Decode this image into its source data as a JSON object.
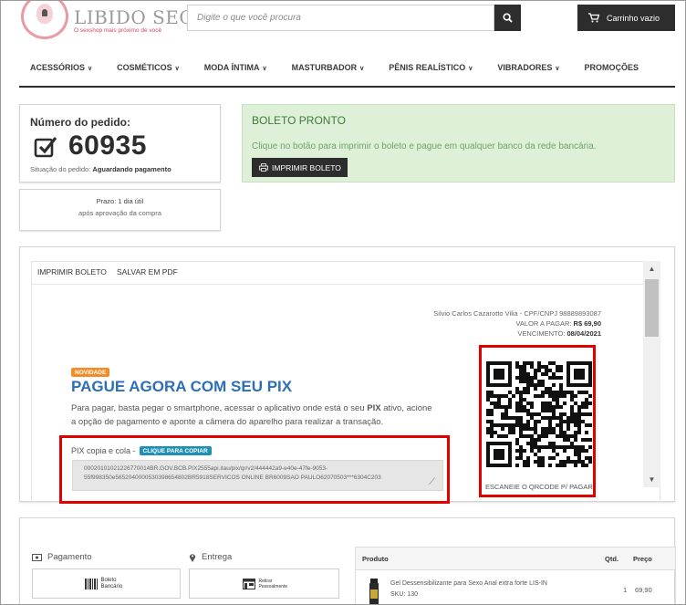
{
  "header": {
    "logo_name": "LIBIDO SECRETO",
    "logo_tagline": "O sexshop mais próximo de você",
    "search_placeholder": "Digite o que você procura",
    "cart_label": "Carrinho vazio"
  },
  "nav": {
    "items": [
      {
        "label": "ACESSÓRIOS",
        "has_dropdown": true
      },
      {
        "label": "COSMÉTICOS",
        "has_dropdown": true
      },
      {
        "label": "MODA ÍNTIMA",
        "has_dropdown": true
      },
      {
        "label": "MASTURBADOR",
        "has_dropdown": true
      },
      {
        "label": "PÊNIS REALÍSTICO",
        "has_dropdown": true
      },
      {
        "label": "VIBRADORES",
        "has_dropdown": true
      },
      {
        "label": "PROMOÇÕES",
        "has_dropdown": false
      }
    ]
  },
  "order": {
    "label": "Número do pedido:",
    "number": "60935",
    "status_prefix": "Situação do pedido:",
    "status_value": "Aguardando pagamento",
    "deadline_line1": "Prazo: 1 dia útil",
    "deadline_line2": "após aprovação da compra"
  },
  "boleto": {
    "title": "BOLETO PRONTO",
    "message": "Clique no botão para imprimir o boleto e pague em qualquer banco da rede bancária.",
    "print_label": "IMPRIMIR BOLETO"
  },
  "viewer": {
    "tabs": [
      "IMPRIMIR BOLETO",
      "SALVAR EM PDF"
    ],
    "payee": "Silvio Carlos Cazarotto Vilia - CPF/CNPJ 98889893087",
    "amount_label": "VALOR A PAGAR:",
    "amount_value": "R$ 69,90",
    "due_label": "VENCIMENTO:",
    "due_value": "08/04/2021",
    "badge": "NOVIDADE",
    "pix_title": "PAGUE AGORA COM SEU PIX",
    "pix_desc_before": "Para pagar, basta pegar o smartphone, acessar o aplicativo onde está o seu",
    "pix_desc_bold": "PIX",
    "pix_desc_after": "ativo, acione a opção de pagamento e aponte a câmera do aparelho para realizar a transação.",
    "copy_label": "PIX copia e cola -",
    "copy_button": "CLIQUE PARA COPIAR",
    "pix_code": "00020101021226770014BR.GOV.BCB.PIX2555api.itau/pix/qr/v2/444442a9-e40e-47fe-9053-55f998350e5652040000530398654802BR5918SERVICOS ONLINE BR6009SAO PAULO62070503***6304C203",
    "qr_caption": "ESCANEIE O QRCODE P/ PAGAR!"
  },
  "summary": {
    "payment_label": "Pagamento",
    "payment_method": "Boleto Bancário",
    "delivery_label": "Entrega",
    "delivery_method": "Retirar Pessoalmente",
    "table_headers": [
      "Produto",
      "Qtd.",
      "Preço"
    ],
    "product_name": "Gel Dessensibilizante para Sexo Anal extra forte LIS-IN",
    "product_sku_label": "SKU:",
    "product_sku": "130",
    "product_qty": "1",
    "product_price": "69,90"
  }
}
